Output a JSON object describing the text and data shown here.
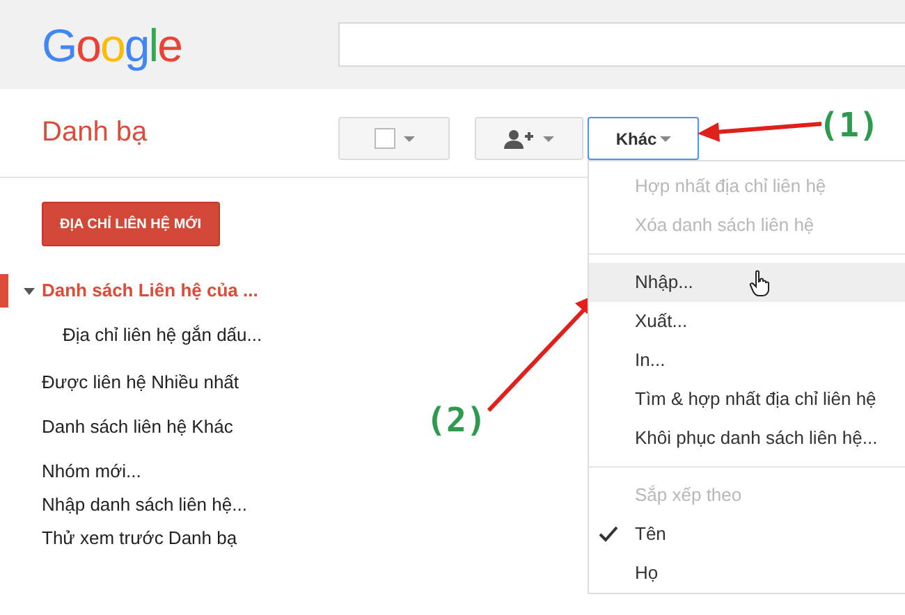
{
  "header": {
    "logo": "Google"
  },
  "app_title": "Danh bạ",
  "toolbar": {
    "more_button": {
      "label": "Khác",
      "expanded": true
    }
  },
  "sidebar": {
    "new_contact_button": "ĐỊA CHỈ LIÊN HỆ MỚI",
    "items": [
      {
        "kind": "list",
        "label": "Danh sách Liên hệ của ...",
        "selected": true,
        "expanded": true,
        "children": [
          {
            "label": "Địa chỉ liên hệ gắn dấu...",
            "selected": false
          }
        ]
      },
      {
        "kind": "list",
        "label": "Được liên hệ Nhiều nhất",
        "selected": false
      },
      {
        "kind": "list",
        "label": "Danh sách liên hệ Khác",
        "selected": false
      },
      {
        "kind": "action",
        "label": "Nhóm mới...",
        "selected": false
      },
      {
        "kind": "action",
        "label": "Nhập danh sách liên hệ...",
        "selected": false
      },
      {
        "kind": "action",
        "label": "Thử xem trước Danh bạ",
        "selected": false
      }
    ]
  },
  "menu": {
    "items": [
      {
        "kind": "item",
        "label": "Hợp nhất địa chỉ liên hệ",
        "disabled": true,
        "selected": false
      },
      {
        "kind": "item",
        "label": "Xóa danh sách liên hệ",
        "disabled": true,
        "selected": false
      },
      {
        "kind": "separator"
      },
      {
        "kind": "item",
        "label": "Nhập...",
        "disabled": false,
        "selected": true
      },
      {
        "kind": "item",
        "label": "Xuất...",
        "disabled": false,
        "selected": false
      },
      {
        "kind": "item",
        "label": "In...",
        "disabled": false,
        "selected": false
      },
      {
        "kind": "item",
        "label": "Tìm & hợp nhất địa chỉ liên hệ",
        "disabled": false,
        "selected": false
      },
      {
        "kind": "item",
        "label": "Khôi phục danh sách liên hệ...",
        "disabled": false,
        "selected": false
      },
      {
        "kind": "separator"
      },
      {
        "kind": "header",
        "label": "Sắp xếp theo"
      },
      {
        "kind": "option",
        "label": "Tên",
        "checked": true
      },
      {
        "kind": "option",
        "label": "Họ",
        "checked": false
      }
    ]
  },
  "annotations": [
    {
      "label": "(1)"
    },
    {
      "label": "(2)"
    }
  ]
}
